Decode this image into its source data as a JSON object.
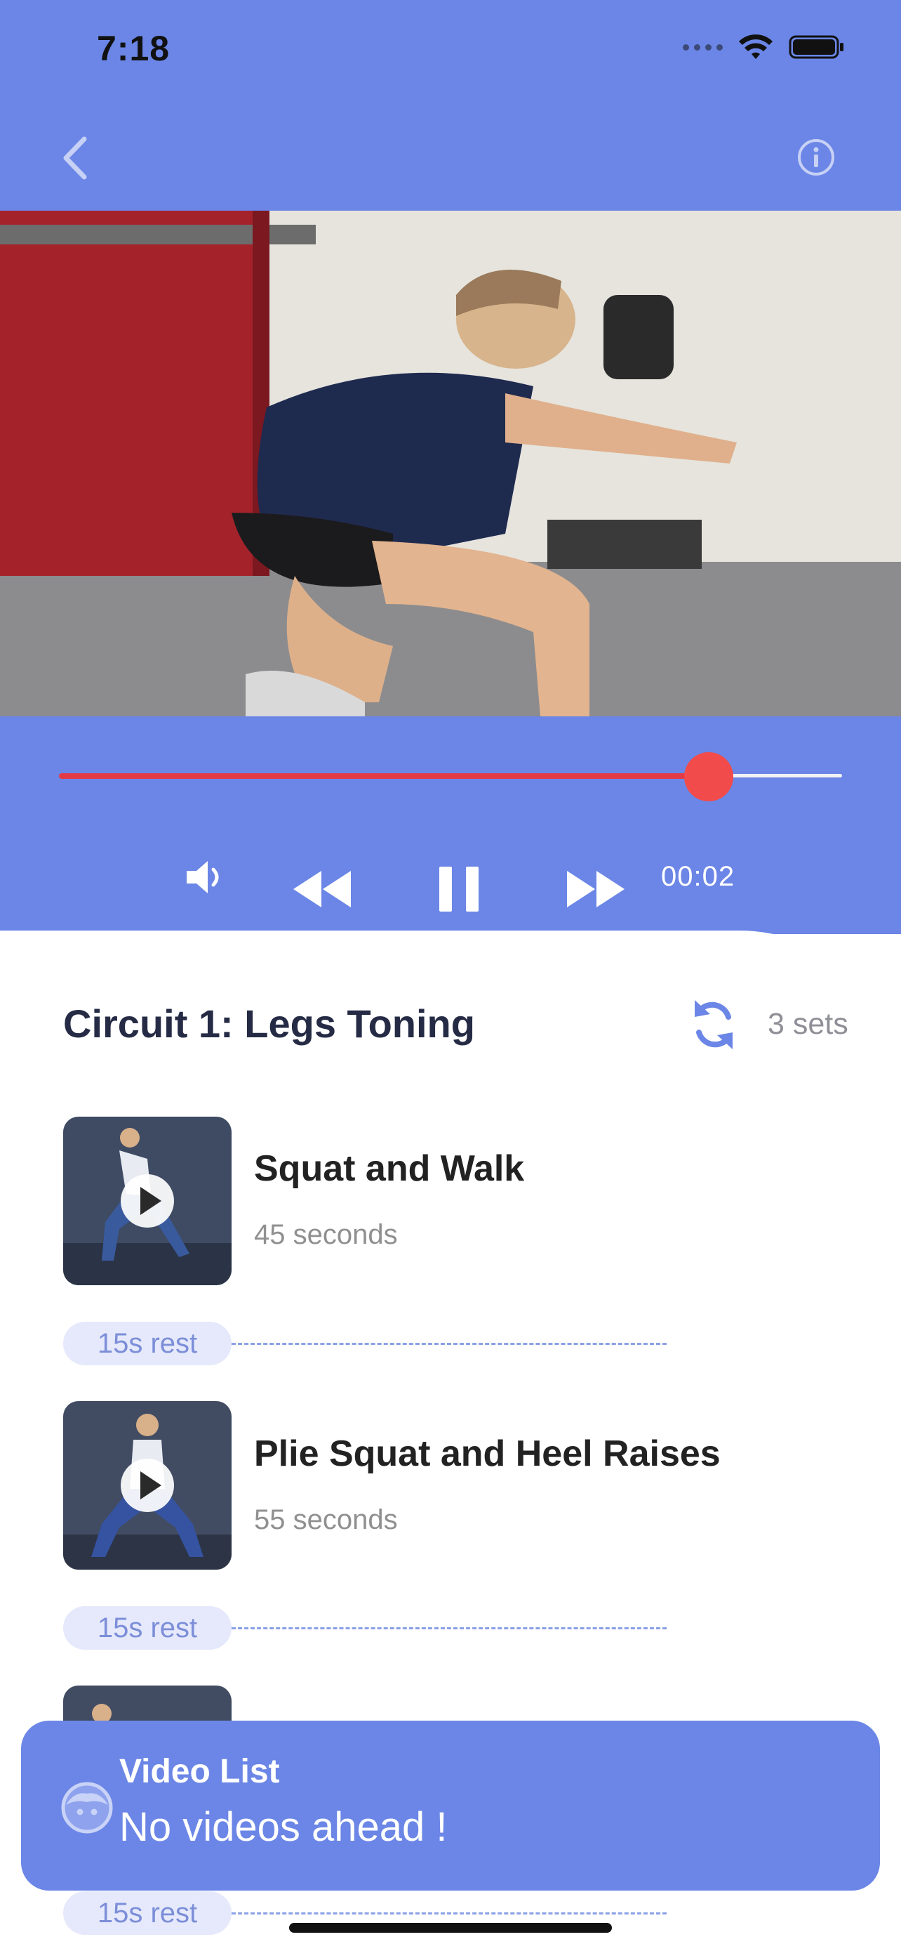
{
  "status_bar": {
    "time": "7:18"
  },
  "nav": {
    "back_icon": "chevron-left-icon",
    "info_icon": "info-icon"
  },
  "player": {
    "progress": 0.83,
    "time": "00:02",
    "icons": [
      "volume-icon",
      "rewind-icon",
      "pause-icon",
      "fast-forward-icon"
    ],
    "accent": "#e23b46"
  },
  "circuit": {
    "title": "Circuit 1: Legs Toning",
    "sets_label": "3 sets"
  },
  "exercises": [
    {
      "name": "Squat and Walk",
      "duration": "45 seconds",
      "rest": "15s rest"
    },
    {
      "name": "Plie Squat and Heel Raises",
      "duration": "55 seconds",
      "rest": "15s rest"
    },
    {
      "name": "",
      "duration": "",
      "rest": "15s rest"
    }
  ],
  "toast": {
    "title": "Video List",
    "message": "No videos ahead !"
  },
  "colors": {
    "primary": "#6b86e6",
    "rest_bg": "#e5e9fb",
    "text_dark": "#262b45"
  }
}
